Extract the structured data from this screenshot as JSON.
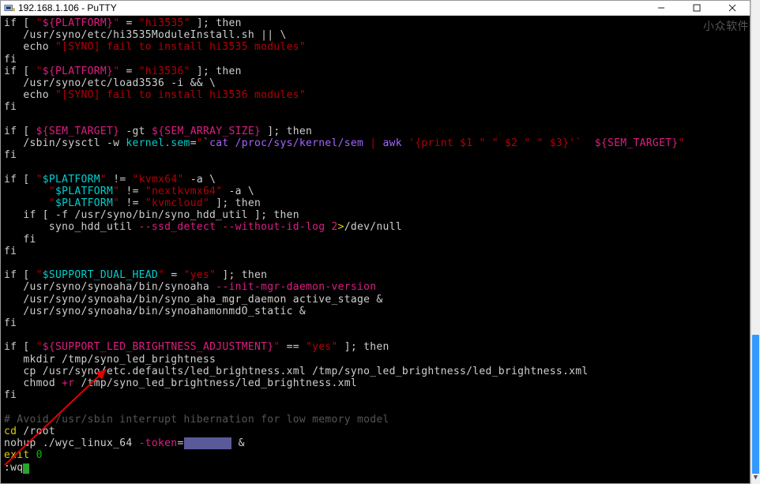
{
  "window": {
    "title": "192.168.1.106 - PuTTY"
  },
  "watermark": "小众软件",
  "term": {
    "lines": [
      {
        "t": [
          [
            "w",
            "if [ "
          ],
          [
            "r",
            "\""
          ],
          [
            "m",
            "${PLATFORM}"
          ],
          [
            "r",
            "\""
          ],
          [
            "w",
            " = "
          ],
          [
            "r",
            "\"hi3535\""
          ],
          [
            "w",
            " ]; then"
          ]
        ]
      },
      {
        "t": [
          [
            "w",
            "   /usr/syno/etc/hi3535ModuleInstall.sh || \\"
          ]
        ]
      },
      {
        "t": [
          [
            "w",
            "   echo "
          ],
          [
            "r",
            "\"[SYNO] fail to install hi3535 modules\""
          ]
        ]
      },
      {
        "t": [
          [
            "w",
            "fi"
          ]
        ]
      },
      {
        "t": [
          [
            "w",
            "if [ "
          ],
          [
            "r",
            "\""
          ],
          [
            "m",
            "${PLATFORM}"
          ],
          [
            "r",
            "\""
          ],
          [
            "w",
            " = "
          ],
          [
            "r",
            "\"hi3536\""
          ],
          [
            "w",
            " ]; then"
          ]
        ]
      },
      {
        "t": [
          [
            "w",
            "   /usr/syno/etc/load3536 -i && \\"
          ]
        ]
      },
      {
        "t": [
          [
            "w",
            "   echo "
          ],
          [
            "r",
            "\"[SYNO] fail to install hi3536 modules\""
          ]
        ]
      },
      {
        "t": [
          [
            "w",
            "fi"
          ]
        ]
      },
      {
        "t": [
          [
            "w",
            " "
          ]
        ]
      },
      {
        "t": [
          [
            "w",
            "if [ "
          ],
          [
            "m",
            "${SEM_TARGET}"
          ],
          [
            "w",
            " -gt "
          ],
          [
            "m",
            "${SEM_ARRAY_SIZE}"
          ],
          [
            "w",
            " ]; then"
          ]
        ]
      },
      {
        "t": [
          [
            "w",
            "   /sbin/sysctl -w "
          ],
          [
            "c",
            "kernel.sem"
          ],
          [
            "w",
            "="
          ],
          [
            "r",
            "\""
          ],
          [
            "p",
            "`cat /proc/sys/kernel/sem "
          ],
          [
            "r",
            "|"
          ],
          [
            "p",
            " awk "
          ],
          [
            "r",
            "'{print $1 \" \" $2 \" \" $3}'`"
          ],
          [
            "p",
            "  "
          ],
          [
            "m",
            "${SEM_TARGET}"
          ],
          [
            "r",
            "\""
          ]
        ]
      },
      {
        "t": [
          [
            "w",
            "fi"
          ]
        ]
      },
      {
        "t": [
          [
            "w",
            " "
          ]
        ]
      },
      {
        "t": [
          [
            "w",
            "if [ "
          ],
          [
            "r",
            "\""
          ],
          [
            "c",
            "$PLATFORM"
          ],
          [
            "r",
            "\""
          ],
          [
            "w",
            " != "
          ],
          [
            "r",
            "\"kvmx64\""
          ],
          [
            "w",
            " -a \\"
          ]
        ]
      },
      {
        "t": [
          [
            "w",
            "       "
          ],
          [
            "r",
            "\""
          ],
          [
            "c",
            "$PLATFORM"
          ],
          [
            "r",
            "\""
          ],
          [
            "w",
            " != "
          ],
          [
            "r",
            "\"nextkvmx64\""
          ],
          [
            "w",
            " -a \\"
          ]
        ]
      },
      {
        "t": [
          [
            "w",
            "       "
          ],
          [
            "r",
            "\""
          ],
          [
            "c",
            "$PLATFORM"
          ],
          [
            "r",
            "\""
          ],
          [
            "w",
            " != "
          ],
          [
            "r",
            "\"kvmcloud\""
          ],
          [
            "w",
            " ]; then"
          ]
        ]
      },
      {
        "t": [
          [
            "w",
            "   if [ -f /usr/syno/bin/syno_hdd_util ]; then"
          ]
        ]
      },
      {
        "t": [
          [
            "w",
            "       syno_hdd_util "
          ],
          [
            "m",
            "--ssd_detect --without-id-log"
          ],
          [
            "w",
            " "
          ],
          [
            "m",
            "2"
          ],
          [
            "y",
            ">"
          ],
          [
            "w",
            "/dev/null"
          ]
        ]
      },
      {
        "t": [
          [
            "w",
            "   fi"
          ]
        ]
      },
      {
        "t": [
          [
            "w",
            "fi"
          ]
        ]
      },
      {
        "t": [
          [
            "w",
            " "
          ]
        ]
      },
      {
        "t": [
          [
            "w",
            "if [ "
          ],
          [
            "r",
            "\""
          ],
          [
            "c",
            "$SUPPORT_DUAL_HEAD"
          ],
          [
            "r",
            "\""
          ],
          [
            "w",
            " = "
          ],
          [
            "r",
            "\"yes\""
          ],
          [
            "w",
            " ]; then"
          ]
        ]
      },
      {
        "t": [
          [
            "w",
            "   /usr/syno/synoaha/bin/synoaha "
          ],
          [
            "m",
            "--init-mgr-daemon-version"
          ]
        ]
      },
      {
        "t": [
          [
            "w",
            "   /usr/syno/synoaha/bin/syno_aha_mgr_daemon active_stage &"
          ]
        ]
      },
      {
        "t": [
          [
            "w",
            "   /usr/syno/synoaha/bin/synoahamonmdO_static &"
          ]
        ]
      },
      {
        "t": [
          [
            "w",
            "fi"
          ]
        ]
      },
      {
        "t": [
          [
            "w",
            " "
          ]
        ]
      },
      {
        "t": [
          [
            "w",
            "if [ "
          ],
          [
            "r",
            "\""
          ],
          [
            "m",
            "${SUPPORT_LED_BRIGHTNESS_ADJUSTMENT}"
          ],
          [
            "r",
            "\""
          ],
          [
            "w",
            " == "
          ],
          [
            "r",
            "\"yes\""
          ],
          [
            "w",
            " ]; then"
          ]
        ]
      },
      {
        "t": [
          [
            "w",
            "   mkdir /tmp/syno_led_brightness"
          ]
        ]
      },
      {
        "t": [
          [
            "w",
            "   cp /usr/syno/etc.defaults/led_brightness.xml /tmp/syno_led_brightness/led_brightness.xml"
          ]
        ]
      },
      {
        "t": [
          [
            "w",
            "   chmod "
          ],
          [
            "m",
            "+r"
          ],
          [
            "w",
            " /tmp/syno_led_brightness/led_brightness.xml"
          ]
        ]
      },
      {
        "t": [
          [
            "w",
            "fi"
          ]
        ]
      },
      {
        "t": [
          [
            "w",
            " "
          ]
        ]
      },
      {
        "t": [
          [
            "gr",
            "# Avoid /usr/sbin interrupt hibernation for low memory model"
          ]
        ]
      },
      {
        "t": [
          [
            "y",
            "cd"
          ],
          [
            "w",
            " /root"
          ]
        ]
      },
      {
        "t": [
          [
            "w",
            "nohup ./wyc_linux_64 "
          ],
          [
            "m",
            "-token"
          ],
          [
            "w",
            "="
          ],
          [
            "bl",
            "       "
          ],
          [
            "w",
            " &"
          ]
        ]
      },
      {
        "t": [
          [
            "y",
            "exit"
          ],
          [
            "g",
            " 0"
          ]
        ]
      },
      {
        "t": [
          [
            "w",
            ":wq"
          ],
          [
            "cursor",
            ""
          ]
        ]
      }
    ]
  },
  "btn": {
    "min": "—",
    "max": "▢",
    "close": "✕"
  }
}
